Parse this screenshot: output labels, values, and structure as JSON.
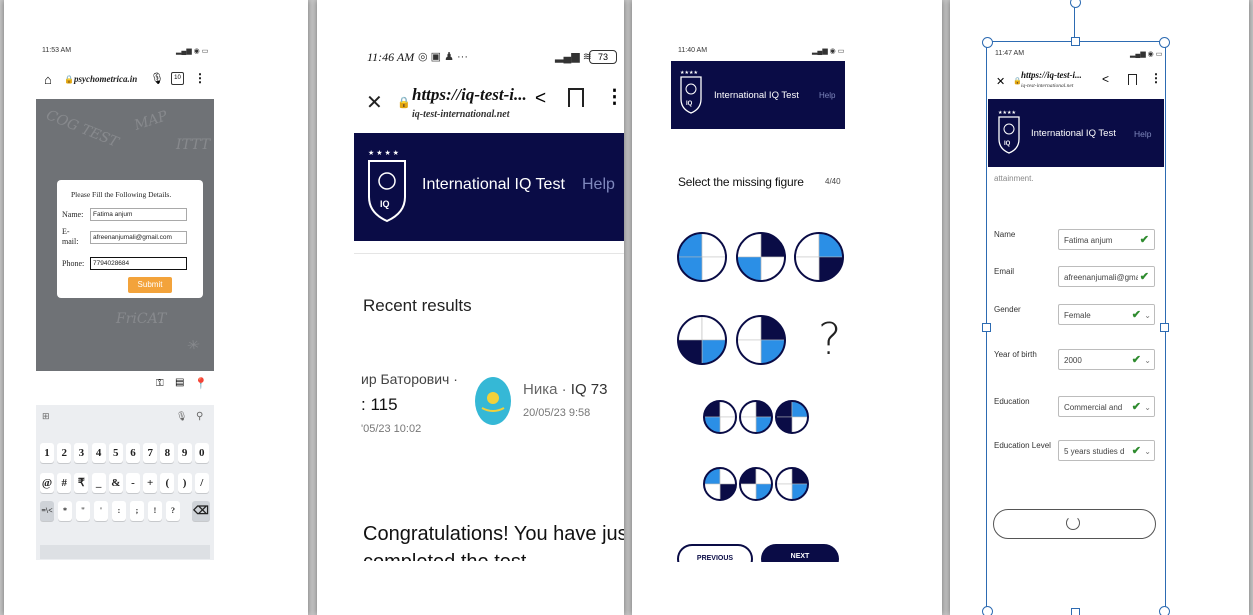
{
  "panel1": {
    "status_time": "11:53 AM",
    "url": "psychometrica.in",
    "dialog": {
      "title": "Please Fill the Following Details.",
      "name_label": "Name:",
      "name_value": "Fatima anjum",
      "email_label_1": "E-",
      "email_label_2": "mail:",
      "email_value": "afreenanjumali@gmail.com",
      "phone_label": "Phone:",
      "phone_value": "7794028684",
      "submit_label": "Submit"
    },
    "keyboard": {
      "row_numbers": [
        "1",
        "2",
        "3",
        "4",
        "5",
        "6",
        "7",
        "8",
        "9",
        "0"
      ],
      "row_symbols": [
        "@",
        "#",
        "₹",
        "_",
        "&",
        "-",
        "+",
        "(",
        ")",
        "/"
      ],
      "row_third": [
        "=\\<",
        "*",
        "\"",
        "'",
        ":",
        ";",
        "!",
        "?"
      ]
    }
  },
  "panel2": {
    "status_time": "11:46 AM",
    "battery": "73",
    "url_main": "https://iq-test-i...",
    "url_sub": "iq-test-international.net",
    "brand": "International IQ Test",
    "help": "Help",
    "recent_results": "Recent results",
    "result1_name": "ир Баторович ·",
    "result1_score": ": 115",
    "result1_date": "'05/23 10:02",
    "result2_name": "Ника · ",
    "result2_score": "IQ 73",
    "result2_date": "20/05/23 9:58",
    "congrats_1": "Congratulations! You have just",
    "congrats_2": "completed the test"
  },
  "panel3": {
    "status_time": "11:40 AM",
    "brand": "International IQ Test",
    "help": "Help",
    "question": "Select the missing figure",
    "progress": "4/40",
    "missing": "?",
    "prev_label": "PREVIOUS",
    "next_label": "NEXT"
  },
  "panel4": {
    "status_time": "11:47 AM",
    "url_main": "https://iq-test-i...",
    "url_sub": "iq-test-international.net",
    "brand": "International IQ Test",
    "help": "Help",
    "attainment": "attainment.",
    "fields": [
      {
        "label": "Name",
        "value": "Fatima anjum"
      },
      {
        "label": "Email",
        "value": "afreenanjumali@gmail"
      },
      {
        "label": "Gender",
        "value": "Female"
      },
      {
        "label": "Year of birth",
        "value": "2000"
      },
      {
        "label": "Education",
        "value": "Commercial and"
      },
      {
        "label": "Education Level",
        "value": "5 years studies d"
      }
    ]
  },
  "colors": {
    "navy": "#0a0c46",
    "quiz_blue": "#2b8fe6",
    "submit_orange": "#f3a33b",
    "check_green": "#2e8b2e"
  }
}
